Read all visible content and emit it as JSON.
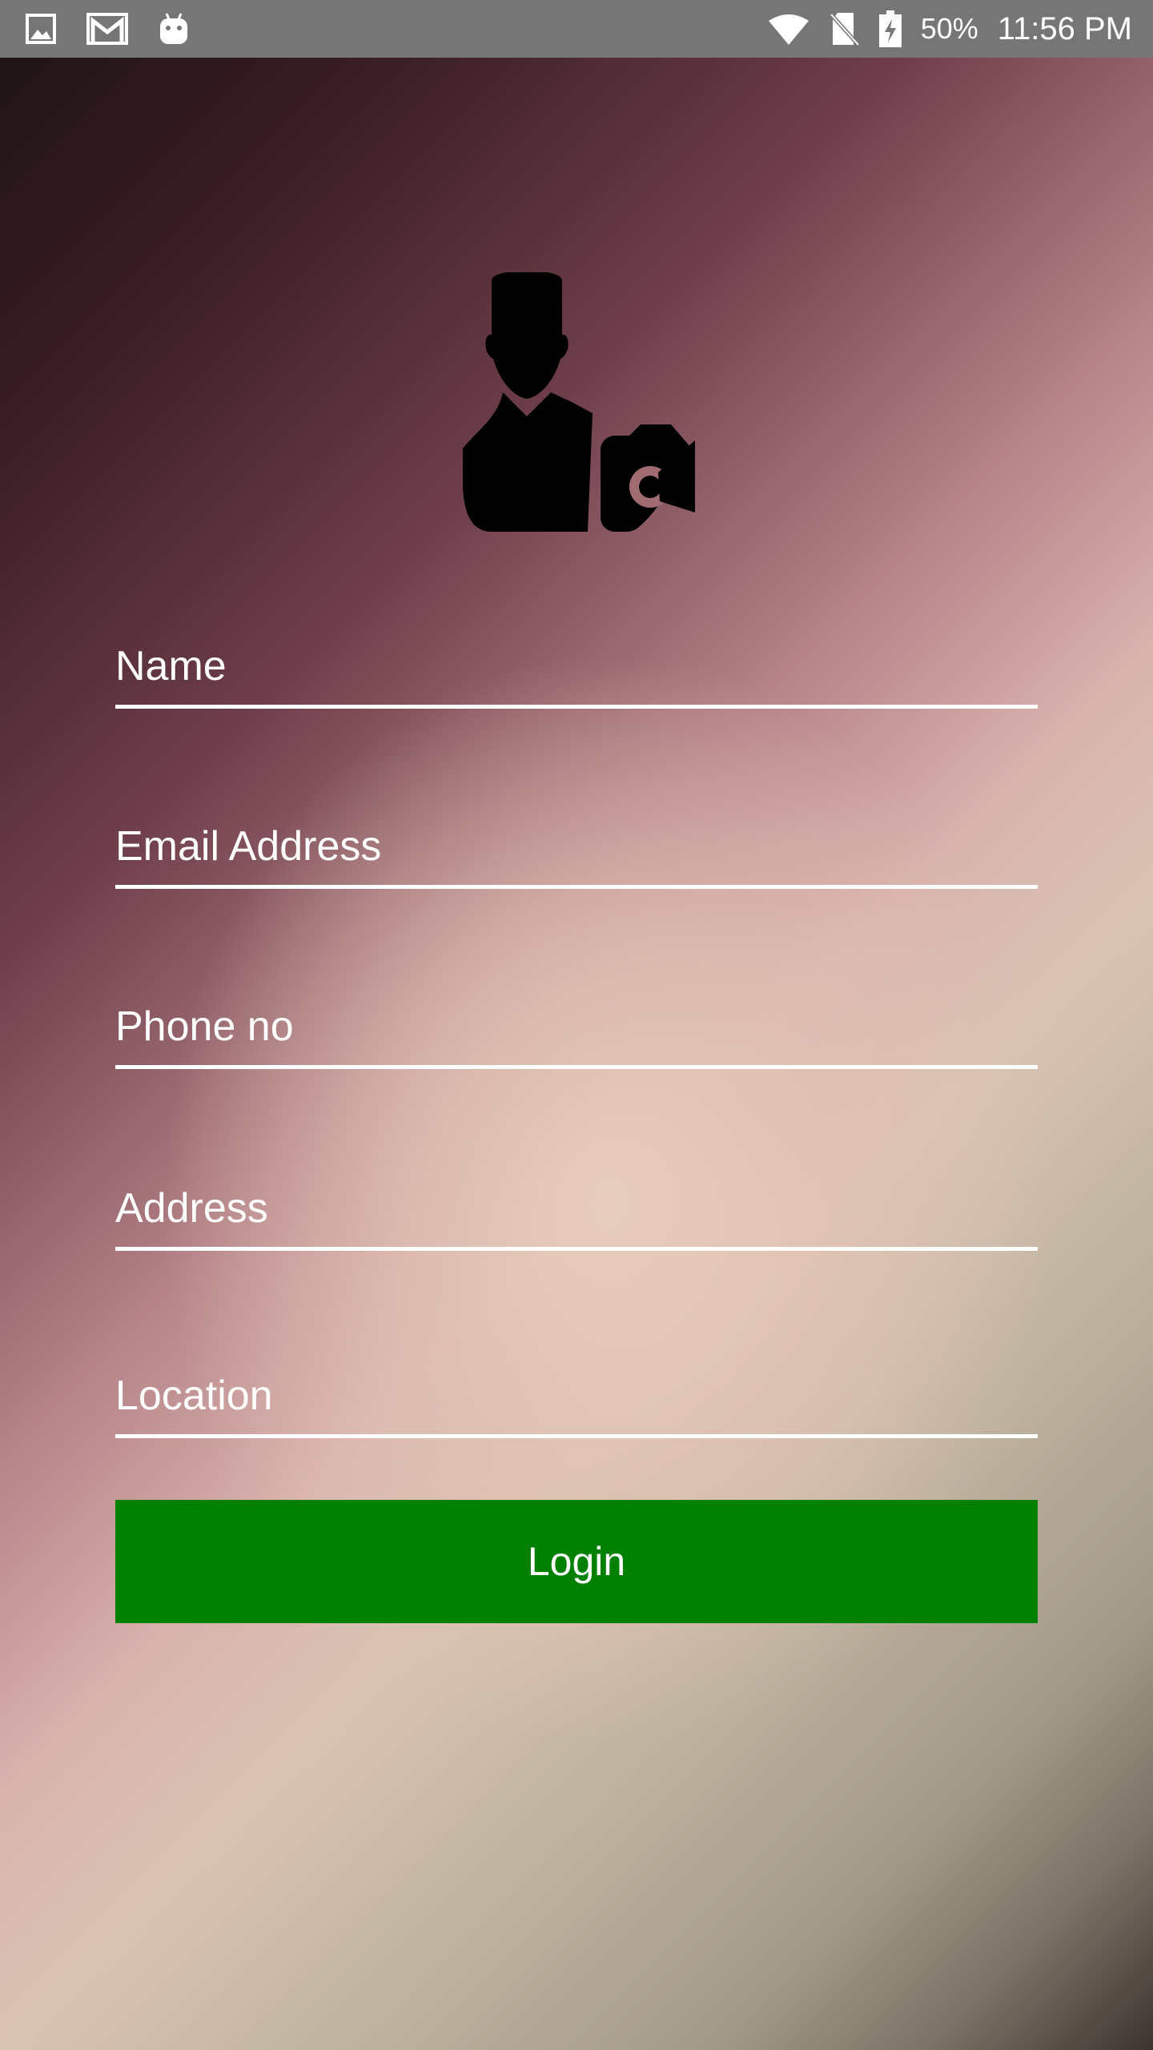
{
  "status_bar": {
    "left_icons": [
      "image-icon",
      "gmail-icon",
      "android-icon"
    ],
    "right_icons": [
      "wifi-icon",
      "no-sim-icon",
      "battery-charging-icon"
    ],
    "battery_percent": "50%",
    "time": "11:56 PM"
  },
  "avatar": {
    "icon": "user-camera-icon"
  },
  "form": {
    "name_placeholder": "Name",
    "email_placeholder": "Email Address",
    "phone_placeholder": "Phone no",
    "address_placeholder": "Address",
    "location_placeholder": "Location",
    "login_label": "Login"
  },
  "colors": {
    "status_bar": "#767676",
    "login_button": "#008000",
    "text": "#ffffff"
  }
}
